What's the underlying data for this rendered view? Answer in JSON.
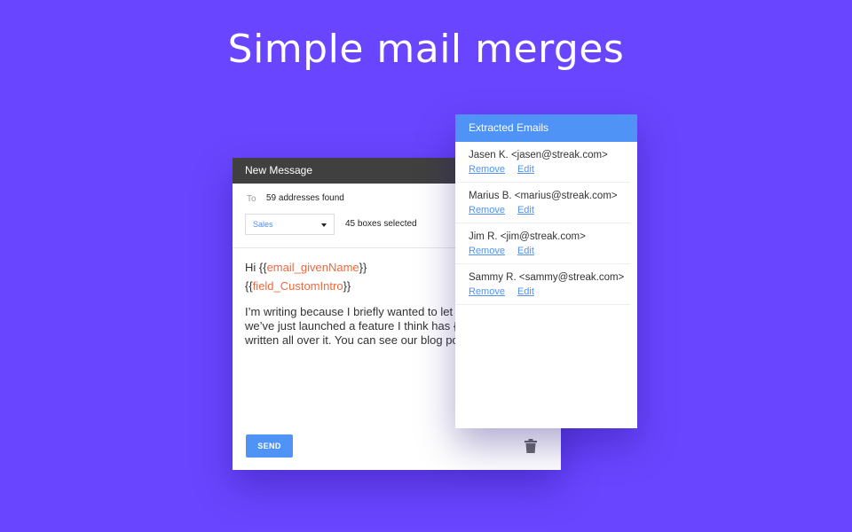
{
  "headline": "Simple mail merges",
  "compose": {
    "title": "New Message",
    "to_label": "To",
    "addresses": "59 addresses found",
    "select_value": "Sales",
    "boxes_selected": "45 boxes selected",
    "greeting_prefix": "Hi {{",
    "greeting_var": "email_givenName",
    "greeting_suffix": "}}",
    "intro_prefix": "{{",
    "intro_var": "field_CustomIntro",
    "intro_suffix": "}}",
    "paragraph_lines": [
      "I’m writing because I briefly wanted to let",
      "we’ve just launched a feature I think has {",
      "written all over it. You can see our blog po"
    ],
    "send_label": "SEND"
  },
  "panel": {
    "title": "Extracted Emails",
    "remove_label": "Remove",
    "edit_label": "Edit",
    "entries": [
      {
        "name": "Jasen K. <jasen@streak.com>"
      },
      {
        "name": "Marius B. <marius@streak.com>"
      },
      {
        "name": "Jim R. <jim@streak.com>"
      },
      {
        "name": "Sammy R. <sammy@streak.com>"
      }
    ]
  },
  "colors": {
    "background": "#6a45ff",
    "accent": "#4f93f6",
    "merge_field": "#ef6a3e",
    "compose_header": "#404040"
  }
}
